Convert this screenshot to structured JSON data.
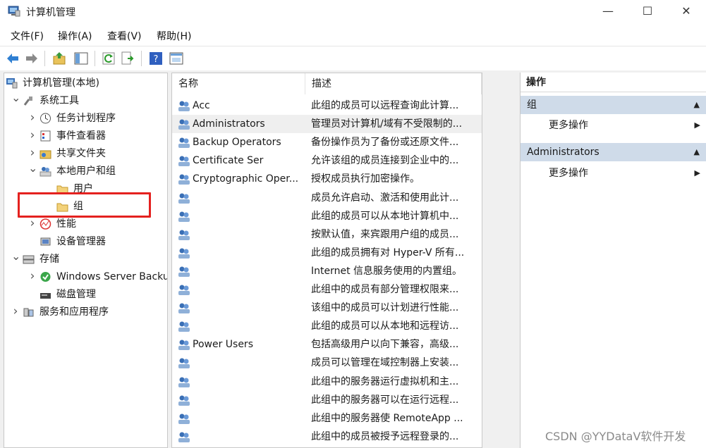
{
  "window": {
    "title": "计算机管理",
    "minimize": "—",
    "maximize": "☐",
    "close": "✕"
  },
  "menu": [
    "文件(F)",
    "操作(A)",
    "查看(V)",
    "帮助(H)"
  ],
  "tree": [
    {
      "label": "计算机管理(本地)",
      "level": 0,
      "arrow": "",
      "icon": "computer-management-icon"
    },
    {
      "label": "系统工具",
      "level": 1,
      "arrow": "v",
      "icon": "tools-icon"
    },
    {
      "label": "任务计划程序",
      "level": 2,
      "arrow": ">",
      "icon": "clock-icon"
    },
    {
      "label": "事件查看器",
      "level": 2,
      "arrow": ">",
      "icon": "event-viewer-icon"
    },
    {
      "label": "共享文件夹",
      "level": 2,
      "arrow": ">",
      "icon": "shared-folder-icon"
    },
    {
      "label": "本地用户和组",
      "level": 2,
      "arrow": "v",
      "icon": "users-icon"
    },
    {
      "label": "用户",
      "level": 3,
      "arrow": "",
      "icon": "folder-icon"
    },
    {
      "label": "组",
      "level": 3,
      "arrow": "",
      "icon": "folder-icon"
    },
    {
      "label": "性能",
      "level": 2,
      "arrow": ">",
      "icon": "performance-icon"
    },
    {
      "label": "设备管理器",
      "level": 2,
      "arrow": "",
      "icon": "device-manager-icon"
    },
    {
      "label": "存储",
      "level": 1,
      "arrow": "v",
      "icon": "storage-icon"
    },
    {
      "label": "Windows Server Backup",
      "level": 2,
      "arrow": ">",
      "icon": "backup-icon"
    },
    {
      "label": "磁盘管理",
      "level": 2,
      "arrow": "",
      "icon": "disk-icon"
    },
    {
      "label": "服务和应用程序",
      "level": 1,
      "arrow": ">",
      "icon": "services-icon"
    }
  ],
  "list": {
    "columns": [
      "名称",
      "描述"
    ],
    "rows": [
      {
        "name": "Acc",
        "desc": "此组的成员可以远程查询此计算..."
      },
      {
        "name": "Administrators",
        "desc": "管理员对计算机/域有不受限制的..."
      },
      {
        "name": "Backup Operators",
        "desc": "备份操作员为了备份或还原文件..."
      },
      {
        "name": "Certificate Ser",
        "desc": "允许该组的成员连接到企业中的..."
      },
      {
        "name": "Cryptographic Oper...",
        "desc": "授权成员执行加密操作。"
      },
      {
        "name": "",
        "desc": "成员允许启动、激活和使用此计..."
      },
      {
        "name": "",
        "desc": "此组的成员可以从本地计算机中..."
      },
      {
        "name": "",
        "desc": "按默认值，来宾跟用户组的成员..."
      },
      {
        "name": "",
        "desc": "此组的成员拥有对 Hyper-V 所有..."
      },
      {
        "name": "",
        "desc": "Internet 信息服务使用的内置组。"
      },
      {
        "name": "",
        "desc": "此组中的成员有部分管理权限来..."
      },
      {
        "name": "",
        "desc": "该组中的成员可以计划进行性能..."
      },
      {
        "name": "",
        "desc": "此组的成员可以从本地和远程访..."
      },
      {
        "name": "Power Users",
        "desc": "包括高级用户以向下兼容，高级..."
      },
      {
        "name": "",
        "desc": "成员可以管理在域控制器上安装..."
      },
      {
        "name": "",
        "desc": "此组中的服务器运行虚拟机和主..."
      },
      {
        "name": "",
        "desc": "此组中的服务器可以在运行远程..."
      },
      {
        "name": "",
        "desc": "此组中的服务器使 RemoteApp ..."
      },
      {
        "name": "",
        "desc": "此组中的成员被授予远程登录的..."
      }
    ]
  },
  "actions": {
    "title": "操作",
    "sections": [
      {
        "name": "组",
        "item": "更多操作"
      },
      {
        "name": "Administrators",
        "item": "更多操作"
      }
    ]
  },
  "watermark": "CSDN @YYDataV软件开发",
  "colors": {
    "highlight": "#e4211f",
    "section_bg": "#cfdbe9"
  }
}
